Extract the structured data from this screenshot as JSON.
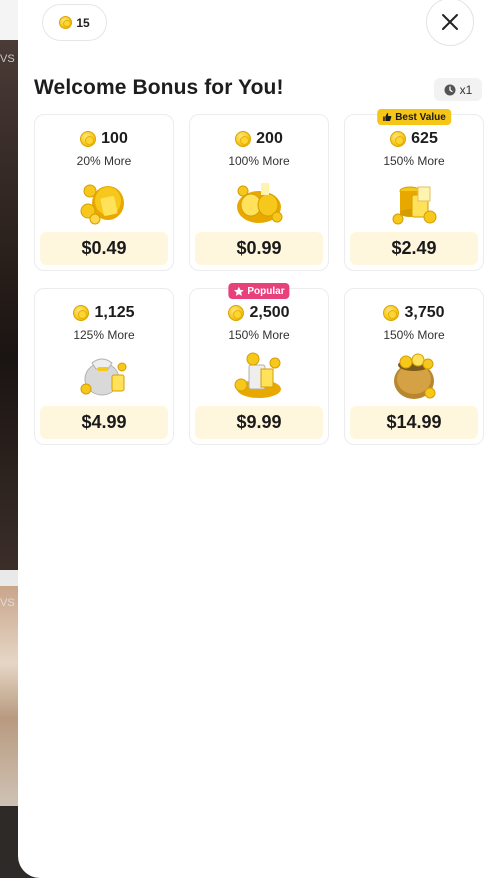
{
  "balance": {
    "amount": "15",
    "icon": "coin-icon"
  },
  "title": "Welcome Bonus for You!",
  "multiplier": {
    "label": "x1",
    "icon": "clock-icon"
  },
  "background": {
    "tag_top": "VS",
    "tag_bottom": "VS"
  },
  "colors": {
    "accent": "#f5c518",
    "popular": "#e8407b",
    "price_bg": "#fff7dd"
  },
  "packages": [
    {
      "coins": "100",
      "bonus": "20% More",
      "price": "$0.49",
      "badge": "",
      "art": "coin-bag"
    },
    {
      "coins": "200",
      "bonus": "100% More",
      "price": "$0.99",
      "badge": "",
      "art": "coin-pile"
    },
    {
      "coins": "625",
      "bonus": "150% More",
      "price": "$2.49",
      "badge": "Best Value",
      "badge_icon": "thumbs-up-icon",
      "art": "coin-stack"
    },
    {
      "coins": "1,125",
      "bonus": "125% More",
      "price": "$4.99",
      "badge": "",
      "art": "silver-bag"
    },
    {
      "coins": "2,500",
      "bonus": "150% More",
      "price": "$9.99",
      "badge": "Popular",
      "badge_icon": "star-icon",
      "art": "coin-heap"
    },
    {
      "coins": "3,750",
      "bonus": "150% More",
      "price": "$14.99",
      "badge": "",
      "art": "coin-pot"
    }
  ]
}
